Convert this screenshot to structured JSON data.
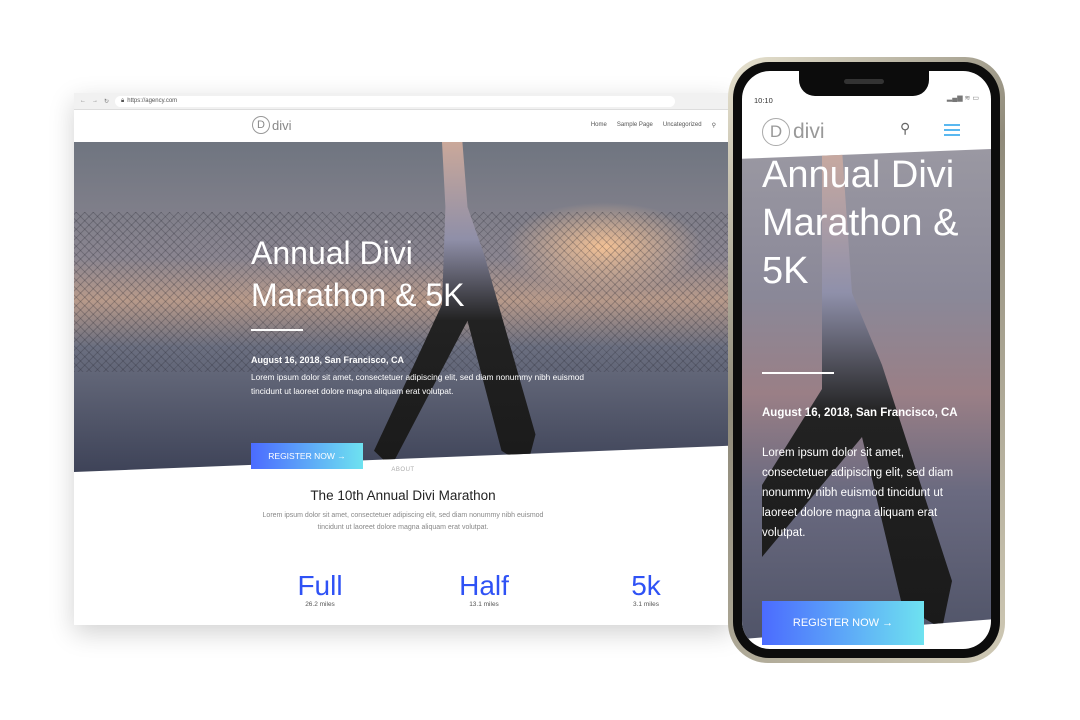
{
  "browser": {
    "url": "https://agency.com"
  },
  "site": {
    "logo": "divi",
    "nav": [
      "Home",
      "Sample Page",
      "Uncategorized"
    ],
    "hero": {
      "title": "Annual Divi Marathon & 5K",
      "date": "August 16, 2018, San Francisco, CA",
      "text": "Lorem ipsum dolor sit amet, consectetuer adipiscing elit, sed diam nonummy nibh euismod tincidunt ut laoreet dolore magna aliquam erat volutpat.",
      "button": "REGISTER NOW →"
    },
    "about": {
      "label": "ABOUT",
      "title": "The 10th Annual Divi Marathon",
      "text": "Lorem ipsum dolor sit amet, consectetuer adipiscing elit, sed diam nonummy nibh euismod tincidunt ut laoreet dolore magna aliquam erat volutpat."
    },
    "stats": [
      {
        "label": "Full",
        "sub": "26.2 miles"
      },
      {
        "label": "Half",
        "sub": "13.1 miles"
      },
      {
        "label": "5k",
        "sub": "3.1 miles"
      }
    ]
  },
  "phone": {
    "time": "10:10",
    "status": "▂▄▆ ≋ ▭"
  },
  "colors": {
    "accent": "#2f52f5",
    "button_start": "#4b6bff",
    "button_end": "#6ee2f0",
    "menu": "#5ab8f0"
  }
}
